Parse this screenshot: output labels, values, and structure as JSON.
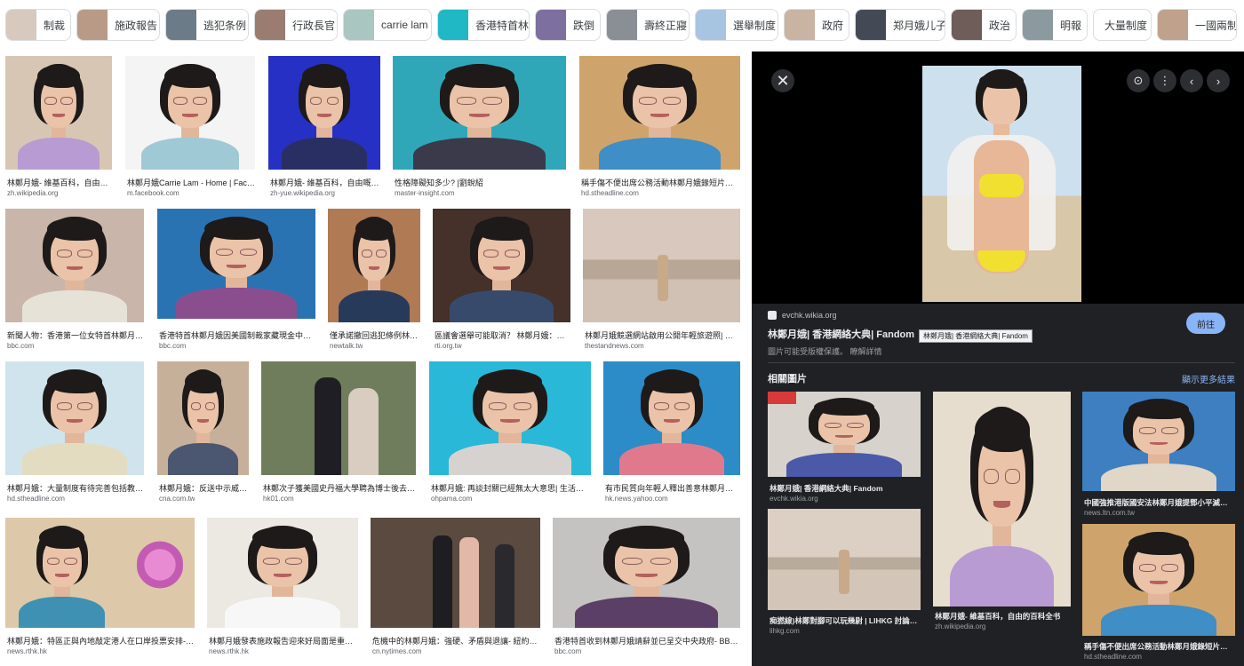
{
  "chips": [
    {
      "label": "制裁"
    },
    {
      "label": "施政報告"
    },
    {
      "label": "逃犯条例"
    },
    {
      "label": "行政長官"
    },
    {
      "label": "carrie lam"
    },
    {
      "label": "香港特首林"
    },
    {
      "label": "跌倒"
    },
    {
      "label": "壽終正寢"
    },
    {
      "label": "選舉制度"
    },
    {
      "label": "政府"
    },
    {
      "label": "郑月娥儿子"
    },
    {
      "label": "政治"
    },
    {
      "label": "明報"
    },
    {
      "label": "大量制度"
    },
    {
      "label": "一國兩制"
    }
  ],
  "results": [
    {
      "caption": "林鄭月娥- 維基百科，自由…",
      "source": "zh.wikipedia.org"
    },
    {
      "caption": "林鄭月娥Carrie Lam - Home | Face…",
      "source": "m.facebook.com"
    },
    {
      "caption": "林鄭月娥- 維基百科，自由嘅…",
      "source": "zh-yue.wikipedia.org"
    },
    {
      "caption": "性格障礙知多少? |劉銳紹",
      "source": "master-insight.com"
    },
    {
      "caption": "稱手傷不便出席公務活動林鄭月娥錄短片代…",
      "source": "hd.stheadline.com"
    },
    {
      "caption": "新聞人物：香港第一位女特首林鄭月…",
      "source": "bbc.com"
    },
    {
      "caption": "香港特首林鄭月娥因美國制裁家藏現金中資…",
      "source": "bbc.com"
    },
    {
      "caption": "僅承諾撤回逃犯條例林…",
      "source": "newtalk.tw"
    },
    {
      "caption": "區議會選舉可能取消？ 林鄭月娥：目…",
      "source": "rti.org.tw"
    },
    {
      "caption": "林鄭月娥競選網站啟用公開年輕旅遊照| 立…",
      "source": "thestandnews.com"
    },
    {
      "caption": "林鄭月娥：大量制度有待完善包括教…",
      "source": "hd.stheadline.com"
    },
    {
      "caption": "林鄭月娥：反送中示威…",
      "source": "cna.com.tw"
    },
    {
      "caption": "林鄭次子獲美國史丹福大學聘為博士後去…",
      "source": "hk01.com"
    },
    {
      "caption": "林鄭月娥: 再談封關已經無太大意思| 生活熱話",
      "source": "ohpama.com"
    },
    {
      "caption": "有市民質向年輕人釋出善意林鄭月娥…",
      "source": "hk.news.yahoo.com"
    },
    {
      "caption": "林鄭月娥：特區正與內地敲定港人在口岸投票安排- …",
      "source": "news.rthk.hk"
    },
    {
      "caption": "林鄭月娥發表施政報告迎來好局面是重新…",
      "source": "news.rthk.hk"
    },
    {
      "caption": "危機中的林鄭月娥：強硬、矛盾與退讓- 紐約時…",
      "source": "cn.nytimes.com"
    },
    {
      "caption": "香港特首收到林鄭月娥請辭並已呈交中央政府- BBC …",
      "source": "bbc.com"
    }
  ],
  "panel": {
    "source": "evchk.wikia.org",
    "title": "林鄭月娥| 香港網絡大典| Fandom",
    "tooltip": "林鄭月娥| 香港網絡大典| Fandom",
    "copyright": "圖片可能受版權保護。 瞭解詳情",
    "visit_label": "前往",
    "close_glyph": "✕",
    "lens_glyph": "⊙",
    "more_glyph": "⋮",
    "prev_glyph": "‹",
    "next_glyph": "›",
    "related_heading": "相關圖片",
    "more_results": "顯示更多結果",
    "related": [
      {
        "caption": "林鄭月娥| 香港網絡大典| Fandom",
        "source": "evchk.wikia.org"
      },
      {
        "caption": "林鄭月娥- 維基百科，自由的百科全书",
        "source": "zh.wikipedia.org"
      },
      {
        "caption": "中國強推港版國安法林鄭月娥提鄧小平滅…",
        "source": "news.ltn.com.tw"
      },
      {
        "caption": "痴撚線)林鄭對腳可以玩幾尉 | LIHKG 討論…",
        "source": "lihkg.com"
      },
      {
        "caption": "稱手傷不便出席公務活動林鄭月娥錄短片…",
        "source": "hd.stheadline.com"
      }
    ]
  },
  "colors": {
    "panel_bg": "#202124",
    "accent": "#8ab4f8",
    "chip_border": "#dadce0"
  }
}
